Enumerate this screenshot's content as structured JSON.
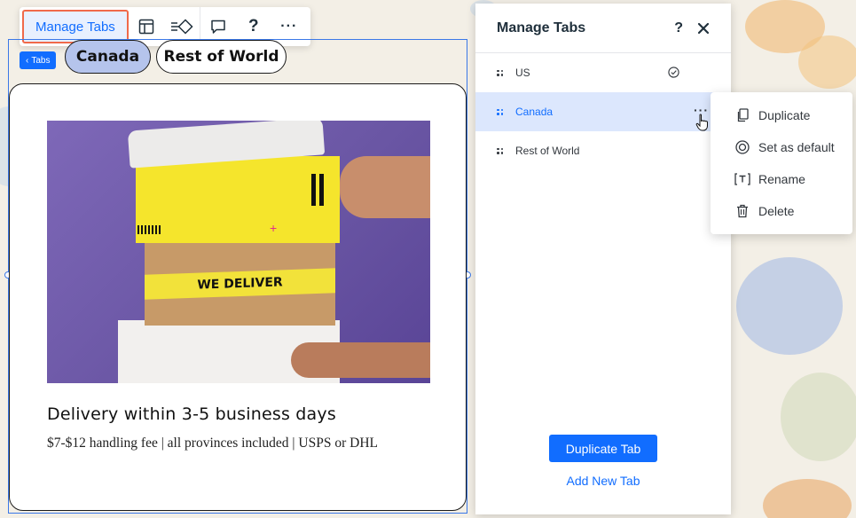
{
  "toolbar": {
    "manage_tabs_label": "Manage Tabs",
    "help_label": "?",
    "more_label": "···"
  },
  "tabs_strip": {
    "tag_label": "Tabs",
    "items": [
      {
        "label": "Canada",
        "active": true
      },
      {
        "label": "Rest of World",
        "active": false
      }
    ]
  },
  "card": {
    "title": "Delivery within 3-5 business days",
    "subtitle": "$7-$12 handling fee | all provinces included | USPS or DHL",
    "tape_text": "WE DELIVER"
  },
  "panel": {
    "title": "Manage Tabs",
    "help_label": "?",
    "tabs": [
      {
        "label": "US",
        "is_default": true,
        "highlighted": false
      },
      {
        "label": "Canada",
        "is_default": false,
        "highlighted": true
      },
      {
        "label": "Rest of World",
        "is_default": false,
        "highlighted": false
      }
    ],
    "row_more_label": "···",
    "duplicate_button": "Duplicate Tab",
    "add_button": "Add New Tab"
  },
  "context_menu": {
    "items": [
      {
        "label": "Duplicate",
        "icon": "duplicate-icon"
      },
      {
        "label": "Set as default",
        "icon": "target-icon"
      },
      {
        "label": "Rename",
        "icon": "rename-icon"
      },
      {
        "label": "Delete",
        "icon": "trash-icon"
      }
    ]
  },
  "colors": {
    "accent": "#116dff",
    "highlight_row": "#dce7fd",
    "active_pill": "#b5c4ec",
    "focus_border": "#f06a4a"
  }
}
